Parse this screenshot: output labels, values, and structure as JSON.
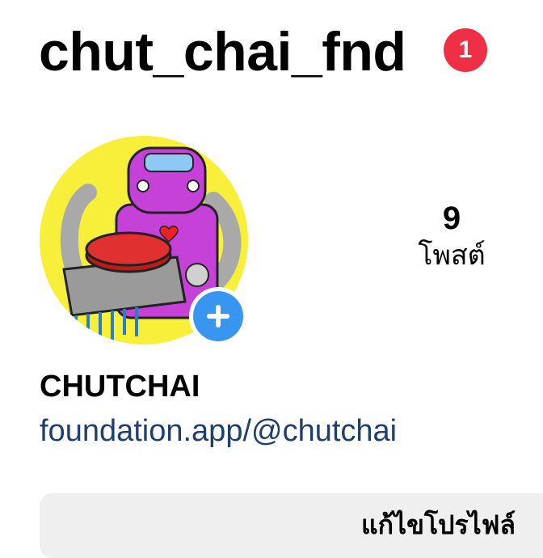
{
  "header": {
    "username": "chut_chai_fnd",
    "notification_count": "1"
  },
  "profile": {
    "avatar_icon": "robot-avatar",
    "add_story_icon": "plus-icon",
    "display_name": "CHUTCHAI",
    "link": "foundation.app/@chutchai"
  },
  "stats": {
    "posts_count": "9",
    "posts_label": "โพสต์"
  },
  "actions": {
    "edit_profile_label": "แก้ไขโปรไฟล์"
  },
  "colors": {
    "notification": "#ee2f45",
    "add_button": "#3896f0",
    "link": "#1f3f6e",
    "avatar_background": "#f7ef3a",
    "robot": "#c641d8"
  }
}
